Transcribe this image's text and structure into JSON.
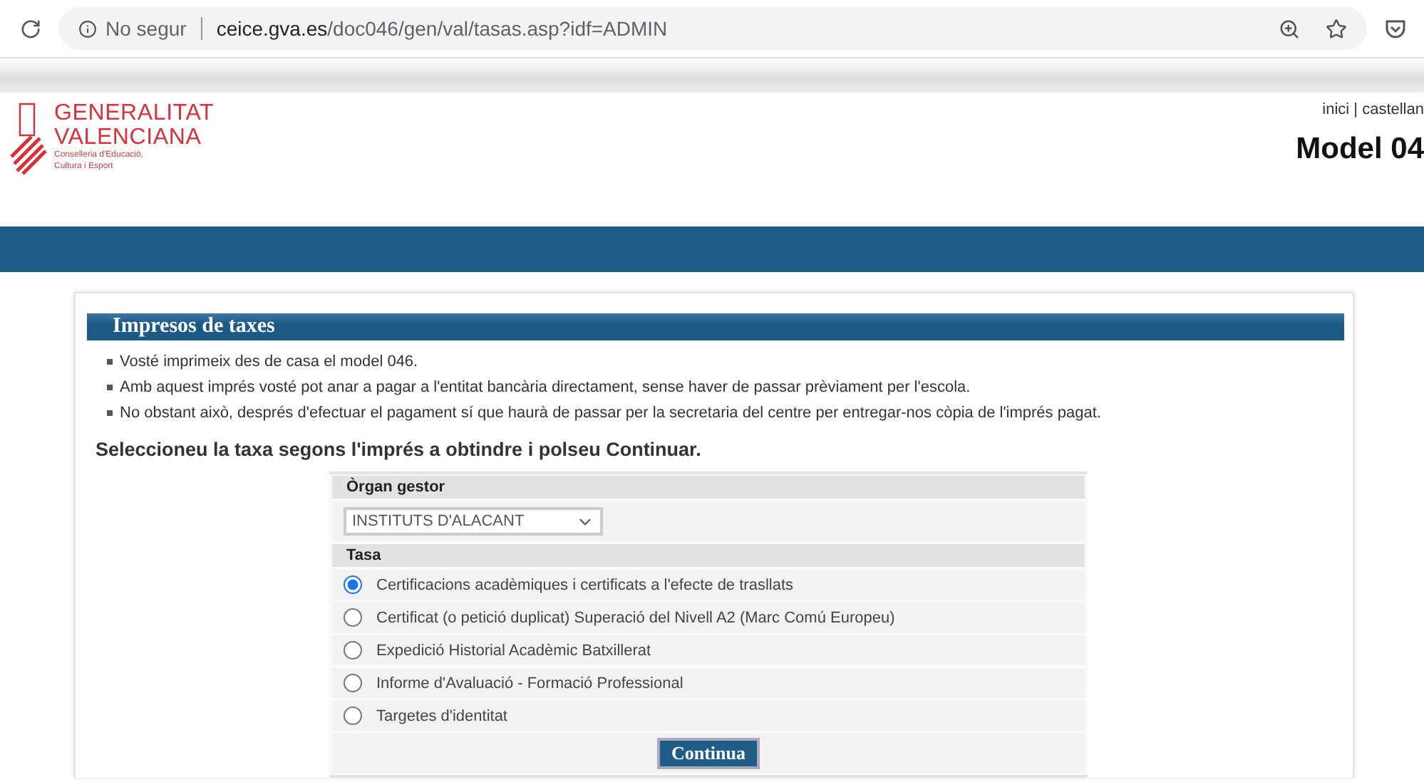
{
  "browser": {
    "security": "No segur",
    "url_host": "ceice.gva.es",
    "url_path": "/doc046/gen/val/tasas.asp?idf=ADMIN"
  },
  "header": {
    "logo_line_1": "GENERALITAT",
    "logo_line_2": "VALENCIANA",
    "logo_sub_1": "Conselleria d'Educació,",
    "logo_sub_2": "Cultura i Esport",
    "nav": "inici | castellan",
    "model": "Model 04"
  },
  "panel": {
    "title": "Impresos de taxes",
    "bullets": [
      "Vosté imprimeix des de casa el model 046.",
      "Amb aquest imprés vosté pot anar a pagar a l'entitat bancària directament, sense haver de passar prèviament per l'escola.",
      "No obstant això, després d'efectuar el pagament sí que haurà de passar per la secretaria del centre per entregar-nos còpia de l'imprés pagat."
    ],
    "instruction": "Seleccioneu la taxa segons l'imprés a obtindre i polseu Continuar.",
    "form": {
      "organ_label": "Òrgan gestor",
      "organ_value": "INSTITUTS D'ALACANT",
      "tasa_label": "Tasa",
      "options": [
        {
          "label": "Certificacions acadèmiques i certificats a l'efecte de trasllats",
          "selected": true
        },
        {
          "label": "Certificat (o petició duplicat) Superació del Nivell A2 (Marc Comú Europeu)",
          "selected": false
        },
        {
          "label": "Expedició Historial Acadèmic Batxillerat",
          "selected": false
        },
        {
          "label": "Informe d'Avaluació - Formació Professional",
          "selected": false
        },
        {
          "label": "Targetes d'identitat",
          "selected": false
        }
      ],
      "button": "Continua"
    }
  }
}
